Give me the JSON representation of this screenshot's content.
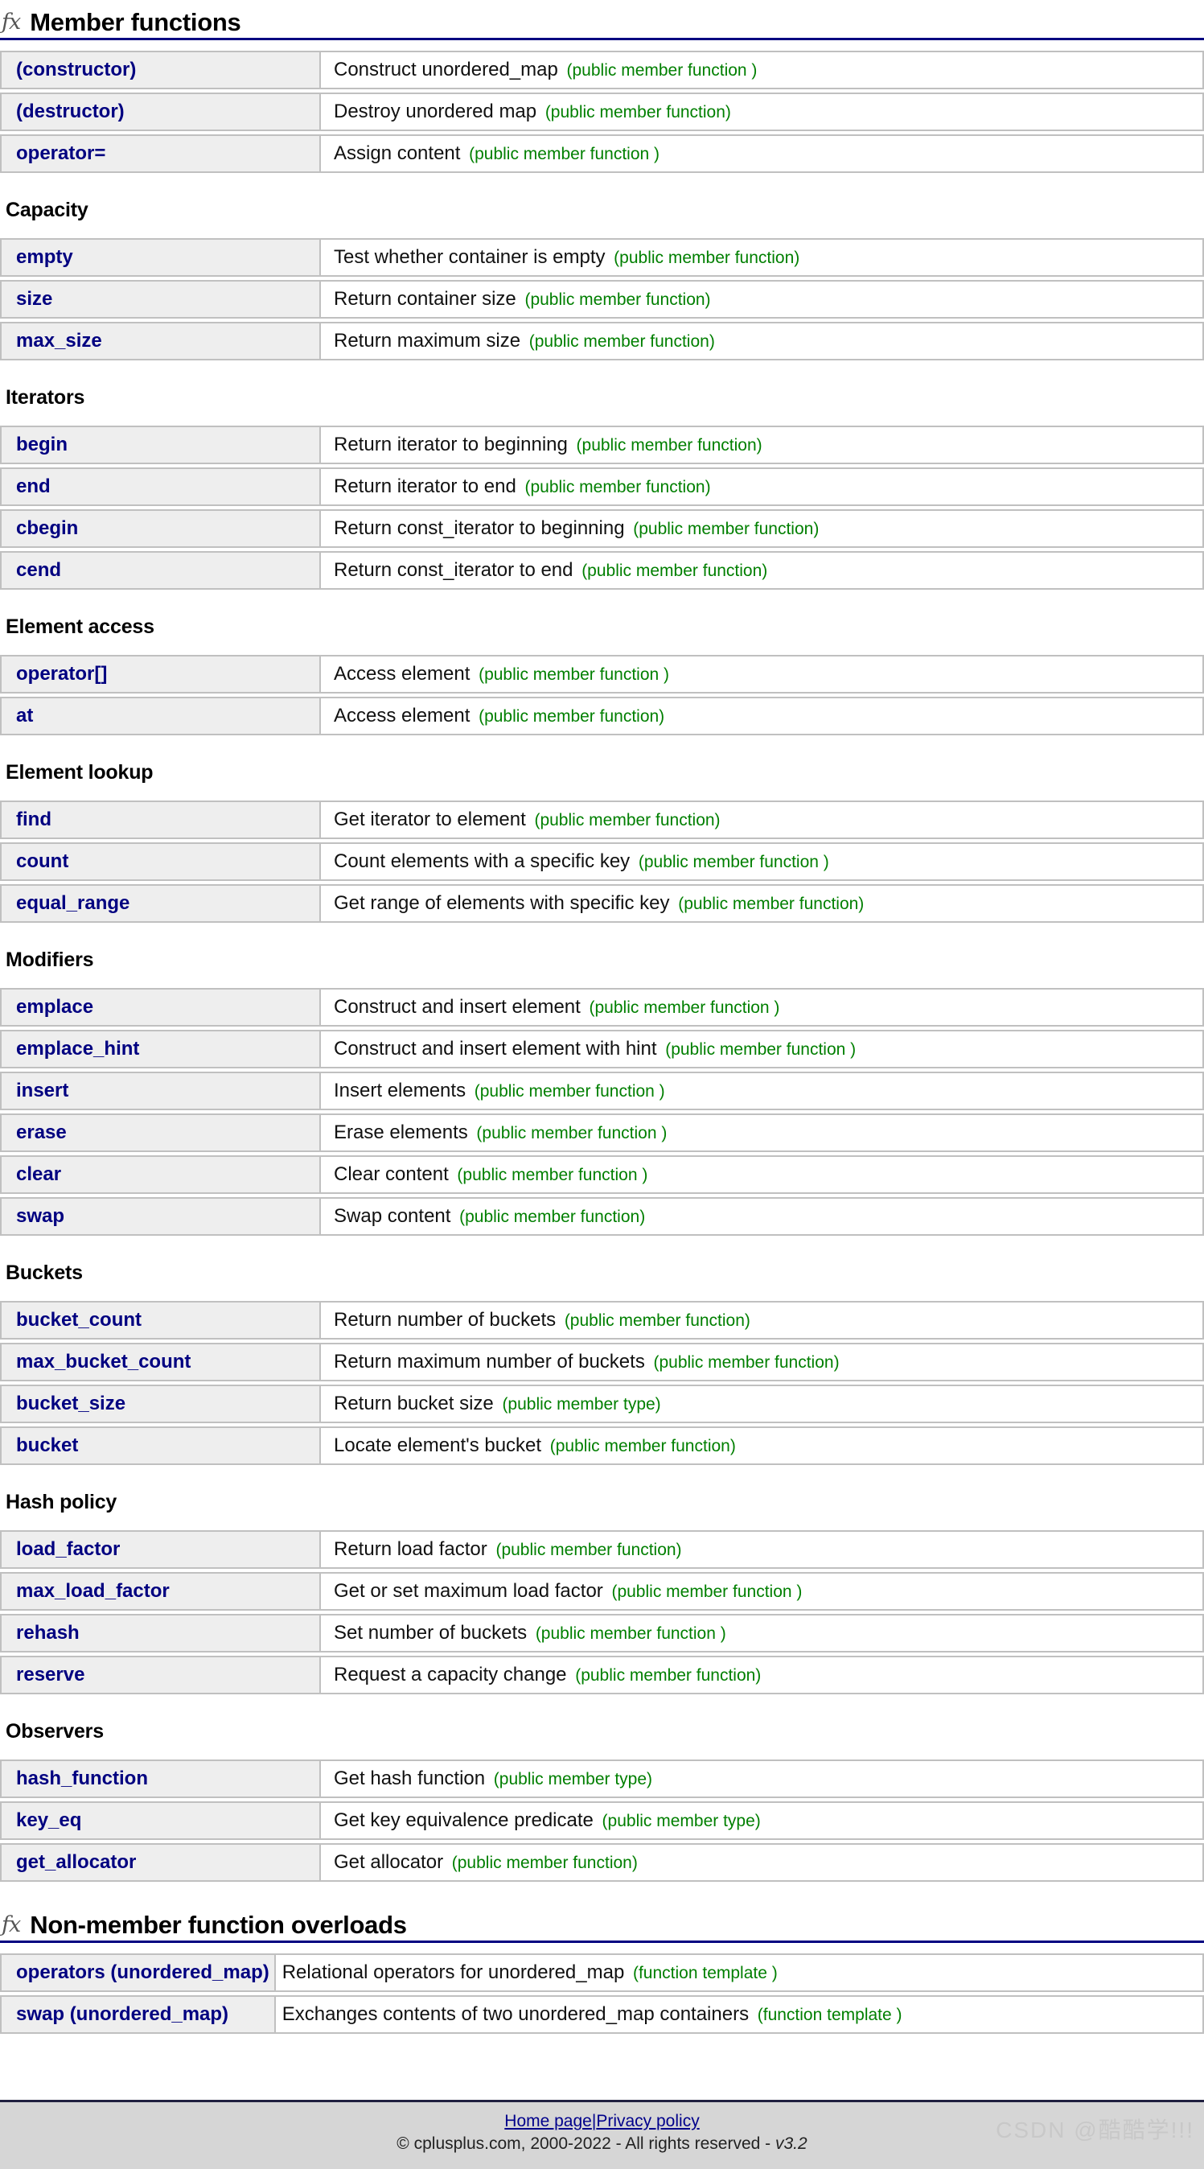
{
  "sections": [
    {
      "icon": "fx-icon",
      "heading": "Member functions",
      "groups": [
        {
          "title": "",
          "rows": [
            {
              "name": "(constructor)",
              "desc": "Construct unordered_map",
              "kind": "(public member function )"
            },
            {
              "name": "(destructor)",
              "desc": "Destroy unordered map",
              "kind": "(public member function)"
            },
            {
              "name": "operator=",
              "desc": "Assign content",
              "kind": "(public member function )"
            }
          ]
        },
        {
          "title": "Capacity",
          "rows": [
            {
              "name": "empty",
              "desc": "Test whether container is empty",
              "kind": "(public member function)"
            },
            {
              "name": "size",
              "desc": "Return container size",
              "kind": "(public member function)"
            },
            {
              "name": "max_size",
              "desc": "Return maximum size",
              "kind": "(public member function)"
            }
          ]
        },
        {
          "title": "Iterators",
          "rows": [
            {
              "name": "begin",
              "desc": "Return iterator to beginning",
              "kind": "(public member function)"
            },
            {
              "name": "end",
              "desc": "Return iterator to end",
              "kind": "(public member function)"
            },
            {
              "name": "cbegin",
              "desc": "Return const_iterator to beginning",
              "kind": "(public member function)"
            },
            {
              "name": "cend",
              "desc": "Return const_iterator to end",
              "kind": "(public member function)"
            }
          ]
        },
        {
          "title": "Element access",
          "rows": [
            {
              "name": "operator[]",
              "desc": "Access element",
              "kind": "(public member function )"
            },
            {
              "name": "at",
              "desc": "Access element",
              "kind": "(public member function)"
            }
          ]
        },
        {
          "title": "Element lookup",
          "rows": [
            {
              "name": "find",
              "desc": "Get iterator to element",
              "kind": "(public member function)"
            },
            {
              "name": "count",
              "desc": "Count elements with a specific key",
              "kind": "(public member function )"
            },
            {
              "name": "equal_range",
              "desc": "Get range of elements with specific key",
              "kind": "(public member function)"
            }
          ]
        },
        {
          "title": "Modifiers",
          "rows": [
            {
              "name": "emplace",
              "desc": "Construct and insert element",
              "kind": "(public member function )"
            },
            {
              "name": "emplace_hint",
              "desc": "Construct and insert element with hint",
              "kind": "(public member function )"
            },
            {
              "name": "insert",
              "desc": "Insert elements",
              "kind": "(public member function )"
            },
            {
              "name": "erase",
              "desc": "Erase elements",
              "kind": "(public member function )"
            },
            {
              "name": "clear",
              "desc": "Clear content",
              "kind": "(public member function )"
            },
            {
              "name": "swap",
              "desc": "Swap content",
              "kind": "(public member function)"
            }
          ]
        },
        {
          "title": "Buckets",
          "rows": [
            {
              "name": "bucket_count",
              "desc": "Return number of buckets",
              "kind": "(public member function)"
            },
            {
              "name": "max_bucket_count",
              "desc": "Return maximum number of buckets",
              "kind": "(public member function)"
            },
            {
              "name": "bucket_size",
              "desc": "Return bucket size",
              "kind": "(public member type)"
            },
            {
              "name": "bucket",
              "desc": "Locate element's bucket",
              "kind": "(public member function)"
            }
          ]
        },
        {
          "title": "Hash policy",
          "rows": [
            {
              "name": "load_factor",
              "desc": "Return load factor",
              "kind": "(public member function)"
            },
            {
              "name": "max_load_factor",
              "desc": "Get or set maximum load factor",
              "kind": "(public member function )"
            },
            {
              "name": "rehash",
              "desc": "Set number of buckets",
              "kind": "(public member function )"
            },
            {
              "name": "reserve",
              "desc": "Request a capacity change",
              "kind": "(public member function)"
            }
          ]
        },
        {
          "title": "Observers",
          "rows": [
            {
              "name": "hash_function",
              "desc": "Get hash function",
              "kind": "(public member type)"
            },
            {
              "name": "key_eq",
              "desc": "Get key equivalence predicate",
              "kind": "(public member type)"
            },
            {
              "name": "get_allocator",
              "desc": "Get allocator",
              "kind": "(public member function)"
            }
          ]
        }
      ]
    },
    {
      "icon": "fx-icon",
      "heading": "Non-member function overloads",
      "groups": [
        {
          "title": "",
          "rows": [
            {
              "name": "operators (unordered_map)",
              "desc": "Relational operators for unordered_map",
              "kind": "(function template )"
            },
            {
              "name": "swap (unordered_map)",
              "desc": "Exchanges contents of two unordered_map containers",
              "kind": "(function template )"
            }
          ]
        }
      ]
    }
  ],
  "footer": {
    "home_link": "Home page",
    "separator": "|",
    "privacy_link": "Privacy policy",
    "copyright": "© cplusplus.com, 2000-2022 - All rights reserved - ",
    "version": "v3.2",
    "watermark": "CSDN @酷酷学!!!"
  },
  "colors": {
    "name_blue": "#000080",
    "kind_green": "#007f00",
    "header_rule": "#000080",
    "row_bg": "#eeeeee",
    "footer_bg": "#d6d6d6"
  },
  "icons": {
    "fx": "ƒx"
  }
}
